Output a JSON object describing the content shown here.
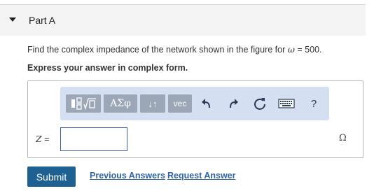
{
  "part": {
    "title": "Part A"
  },
  "question": {
    "text_before": "Find the complex impedance of the network shown in the figure for ",
    "omega_symbol": "ω",
    "text_after": " = 500.",
    "instruction": "Express your answer in complex form."
  },
  "toolbar": {
    "templates_icon": "fraction-sqrt-templates-icon",
    "symbols_label": "ΑΣφ",
    "arrows_label": "↓↑",
    "vec_label": "vec",
    "undo_icon": "undo-arrow-icon",
    "redo_icon": "redo-arrow-icon",
    "reset_icon": "reset-circular-arrow-icon",
    "keyboard_icon": "keyboard-icon",
    "help_label": "?"
  },
  "answer": {
    "variable": "Z",
    "equals": " =",
    "value": "",
    "unit": "Ω"
  },
  "actions": {
    "submit_label": "Submit",
    "previous_answers_label": "Previous Answers",
    "request_answer_label": "Request Answer"
  },
  "colors": {
    "toolbar_bg": "#d4dff1",
    "toolbar_button": "#9ba7b6",
    "submit_bg": "#1e6091",
    "link": "#2f64a8",
    "input_border": "#3e5da8"
  }
}
